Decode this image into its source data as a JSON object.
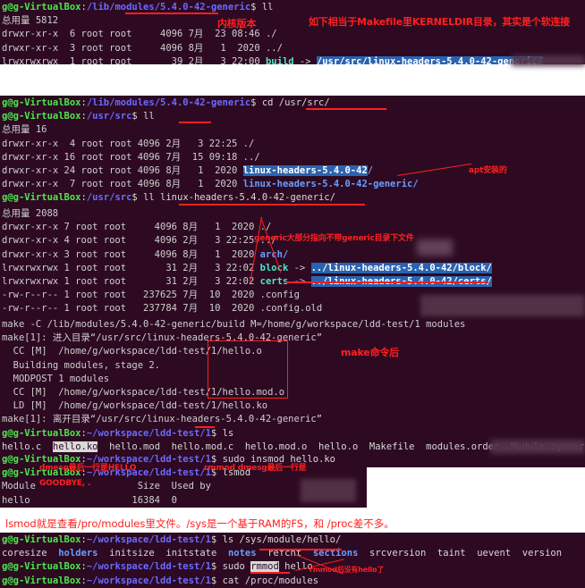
{
  "meta": {
    "prompt_user": "g@g-VirtualBox",
    "colors": {
      "terminal_bg": "#2d0a22",
      "annotation_red": "#ff2020",
      "prompt_green": "#4ce64c",
      "path_blue": "#6a6aff",
      "dir_blue": "#6a9eff",
      "link_cyan": "#4ce6c8",
      "selection_blue": "#2a63b0"
    }
  },
  "block1": {
    "name": "lib-modules-listing",
    "lines": [
      {
        "type": "prompt",
        "path": "/lib/modules/5.4.0-42-generic",
        "cmd": "ll"
      },
      {
        "type": "text",
        "text": "总用量 5812"
      },
      {
        "type": "text",
        "text": "drwxr-xr-x  6 root root     4096 7月  23 08:46 ./"
      },
      {
        "type": "text",
        "text": "drwxr-xr-x  3 root root     4096 8月   1  2020 ../"
      },
      {
        "type": "link",
        "perm": "lrwxrwxrwx  1 root root       39 2月   3 22:00 ",
        "name": "build",
        "arrow": " -> ",
        "target": "/usr/src/linux-headers-5.4.0-42-generic/"
      }
    ]
  },
  "block2": {
    "name": "usr-src-listing",
    "lines": [
      {
        "type": "prompt",
        "path": "/lib/modules/5.4.0-42-generic",
        "cmd": "cd /usr/src/"
      },
      {
        "type": "prompt",
        "path": "/usr/src",
        "cmd": "ll"
      },
      {
        "type": "text",
        "text": "总用量 16"
      },
      {
        "type": "text",
        "text": "drwxr-xr-x  4 root root 4096 2月   3 22:25 ./"
      },
      {
        "type": "text",
        "text": "drwxr-xr-x 16 root root 4096 7月  15 09:18 ../"
      },
      {
        "type": "dirsel",
        "pre": "drwxr-xr-x 24 root root 4096 8月   1  2020 ",
        "sel": "linux-headers-5.4.0-42",
        "post": "/"
      },
      {
        "type": "dir",
        "pre": "drwxr-xr-x  7 root root 4096 8月   1  2020 ",
        "name": "linux-headers-5.4.0-42-generic/"
      },
      {
        "type": "prompt",
        "path": "/usr/src",
        "cmd": "ll linux-headers-5.4.0-42-generic/"
      }
    ]
  },
  "block3": {
    "name": "linux-headers-generic-listing",
    "lines": [
      {
        "type": "text",
        "text": "总用量 2088"
      },
      {
        "type": "text",
        "text": "drwxr-xr-x 7 root root     4096 8月   1  2020 ./"
      },
      {
        "type": "text",
        "text": "drwxr-xr-x 4 root root     4096 2月   3 22:25 ../"
      },
      {
        "type": "dir",
        "pre": "drwxr-xr-x 3 root root     4096 8月   1  2020 ",
        "name": "arch/"
      },
      {
        "type": "link",
        "perm": "lrwxrwxrwx 1 root root       31 2月   3 22:02 ",
        "name": "block",
        "arrow": " -> ",
        "target": "../linux-headers-5.4.0-42/block/"
      },
      {
        "type": "link",
        "perm": "lrwxrwxrwx 1 root root       31 2月   3 22:02 ",
        "name": "certs",
        "arrow": " -> ",
        "target": "../linux-headers-5.4.0-42/certs/"
      },
      {
        "type": "text",
        "text": "-rw-r--r-- 1 root root   237625 7月  10  2020 .config"
      },
      {
        "type": "text",
        "text": "-rw-r--r-- 1 root root   237784 7月  10  2020 .config.old"
      }
    ]
  },
  "block4": {
    "name": "make-build-output",
    "lines": [
      {
        "type": "text",
        "text": "make -C /lib/modules/5.4.0-42-generic/build M=/home/g/workspace/ldd-test/1 modules"
      },
      {
        "type": "text",
        "text": "make[1]: 进入目录“/usr/src/linux-headers-5.4.0-42-generic”"
      },
      {
        "type": "text",
        "text": "  CC [M]  /home/g/workspace/ldd-test/1/hello.o"
      },
      {
        "type": "text",
        "text": "  Building modules, stage 2."
      },
      {
        "type": "text",
        "text": "  MODPOST 1 modules"
      },
      {
        "type": "text",
        "text": "  CC [M]  /home/g/workspace/ldd-test/1/hello.mod.o"
      },
      {
        "type": "text",
        "text": "  LD [M]  /home/g/workspace/ldd-test/1/hello.ko"
      },
      {
        "type": "text",
        "text": "make[1]: 离开目录“/usr/src/linux-headers-5.4.0-42-generic”"
      },
      {
        "type": "prompt",
        "path": "~/workspace/ldd-test/1",
        "cmd": "ls"
      },
      {
        "type": "lssel",
        "pre": "hello.c  ",
        "sel": "hello.ko",
        "post": "  hello.mod  hello.mod.c  hello.mod.o  hello.o  Makefile  modules.order  Module.symvers"
      },
      {
        "type": "prompt",
        "path": "~/workspace/ldd-test/1",
        "cmd": ""
      }
    ]
  },
  "block5": {
    "name": "insmod-lsmod-output",
    "lines": [
      {
        "type": "prompt",
        "path": "~/workspace/ldd-test/1",
        "cmd": "sudo insmod hello.ko"
      },
      {
        "type": "prompt",
        "path": "~/workspace/ldd-test/1",
        "cmd": "lsmod"
      },
      {
        "type": "text",
        "text": "Module                  Size  Used by"
      },
      {
        "type": "text",
        "text": "hello                  16384  0"
      }
    ]
  },
  "block6": {
    "name": "sysfs-rmmod-output",
    "lines": [
      {
        "type": "prompt",
        "path": "~/workspace/ldd-test/1",
        "cmd": "ls /sys/module/hello/"
      },
      {
        "type": "syslist",
        "items": [
          {
            "text": "coresize",
            "kind": "file"
          },
          {
            "text": "holders",
            "kind": "dir"
          },
          {
            "text": "initsize",
            "kind": "file"
          },
          {
            "text": "initstate",
            "kind": "file"
          },
          {
            "text": "notes",
            "kind": "dir"
          },
          {
            "text": "refcnt",
            "kind": "file"
          },
          {
            "text": "sections",
            "kind": "dir"
          },
          {
            "text": "srcversion",
            "kind": "file"
          },
          {
            "text": "taint",
            "kind": "file"
          },
          {
            "text": "uevent",
            "kind": "file"
          },
          {
            "text": "version",
            "kind": "file"
          }
        ]
      },
      {
        "type": "rmmod",
        "path": "~/workspace/ldd-test/1",
        "pre": "sudo ",
        "sel": "rmmod",
        "post": " hello"
      },
      {
        "type": "prompt",
        "path": "~/workspace/ldd-test/1",
        "cmd": "cat /proc/modules"
      }
    ]
  },
  "annotations": {
    "a1": "内核版本",
    "a2": "如下相当于Makefile里KERNELDIR目录，其实是个软连接",
    "a3": "apt安装的",
    "a4": "generic大部分指向不带generic目录下文件",
    "a5": "make命令后",
    "a6": "dmesg最后一行是HELLO",
    "a7": "rmmod dmesg最后一行是",
    "a8": "GOODBYE, .",
    "a9": "lsmod就是查看/pro/modules里文件。/sys是一个基于RAM的FS，和 /proc差不多。",
    "a10": "rmmod后没有hello了"
  }
}
